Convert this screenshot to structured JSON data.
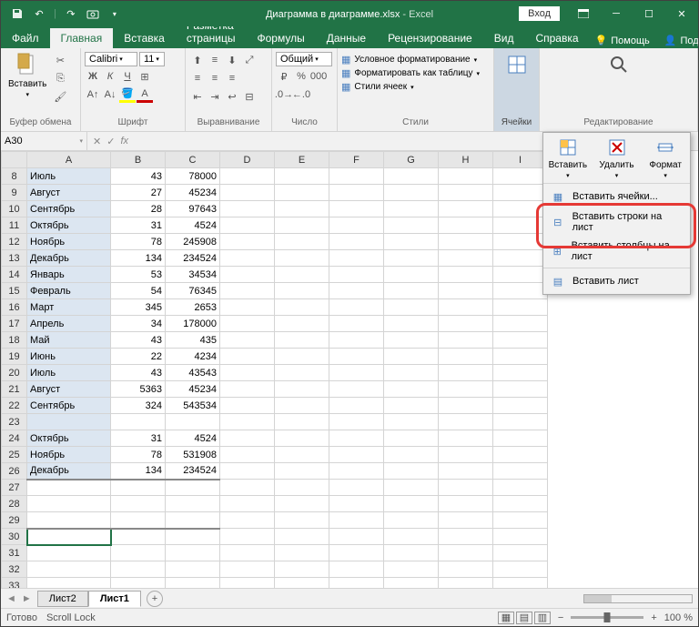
{
  "title": {
    "doc": "Диаграмма в диаграмме.xlsx",
    "sep": " - ",
    "app": "Excel"
  },
  "login": "Вход",
  "tabs": [
    "Файл",
    "Главная",
    "Вставка",
    "Разметка страницы",
    "Формулы",
    "Данные",
    "Рецензирование",
    "Вид",
    "Справка"
  ],
  "activeTab": 1,
  "help": "Помощь",
  "share": "Поделиться",
  "groups": {
    "clipboard": {
      "label": "Буфер обмена",
      "paste": "Вставить"
    },
    "font": {
      "label": "Шрифт",
      "name": "Calibri",
      "size": "11"
    },
    "align": {
      "label": "Выравнивание"
    },
    "number": {
      "label": "Число",
      "format": "Общий"
    },
    "styles": {
      "label": "Стили",
      "cond": "Условное форматирование",
      "table": "Форматировать как таблицу",
      "cells": "Стили ячеек"
    },
    "cells_grp": {
      "label": "Ячейки"
    },
    "editing": {
      "label": "Редактирование"
    }
  },
  "namebox": "A30",
  "cols": [
    "A",
    "B",
    "C",
    "D",
    "E",
    "F",
    "G",
    "H",
    "I"
  ],
  "rows": [
    {
      "n": 8,
      "a": "Июль",
      "b": 43,
      "c": 78000
    },
    {
      "n": 9,
      "a": "Август",
      "b": 27,
      "c": 45234
    },
    {
      "n": 10,
      "a": "Сентябрь",
      "b": 28,
      "c": 97643
    },
    {
      "n": 11,
      "a": "Октябрь",
      "b": 31,
      "c": 4524
    },
    {
      "n": 12,
      "a": "Ноябрь",
      "b": 78,
      "c": 245908
    },
    {
      "n": 13,
      "a": "Декабрь",
      "b": 134,
      "c": 234524
    },
    {
      "n": 14,
      "a": "Январь",
      "b": 53,
      "c": 34534
    },
    {
      "n": 15,
      "a": "Февраль",
      "b": 54,
      "c": 76345
    },
    {
      "n": 16,
      "a": "Март",
      "b": 345,
      "c": 2653
    },
    {
      "n": 17,
      "a": "Апрель",
      "b": 34,
      "c": 178000
    },
    {
      "n": 18,
      "a": "Май",
      "b": 43,
      "c": 435
    },
    {
      "n": 19,
      "a": "Июнь",
      "b": 22,
      "c": 4234
    },
    {
      "n": 20,
      "a": "Июль",
      "b": 43,
      "c": 43543
    },
    {
      "n": 21,
      "a": "Август",
      "b": 5363,
      "c": 45234
    },
    {
      "n": 22,
      "a": "Сентябрь",
      "b": 324,
      "c": 543534
    },
    {
      "n": 23,
      "a": "",
      "b": "",
      "c": ""
    },
    {
      "n": 24,
      "a": "Октябрь",
      "b": 31,
      "c": 4524
    },
    {
      "n": 25,
      "a": "Ноябрь",
      "b": 78,
      "c": 531908
    },
    {
      "n": 26,
      "a": "Декабрь",
      "b": 134,
      "c": 234524
    }
  ],
  "emptyRows": [
    27,
    28,
    29,
    30,
    31,
    32,
    33
  ],
  "sheets": [
    "Лист2",
    "Лист1"
  ],
  "activeSheet": 1,
  "status": {
    "ready": "Готово",
    "scroll": "Scroll Lock",
    "zoom": "100 %"
  },
  "dropdown": {
    "mini": {
      "insert": "Вставить",
      "delete": "Удалить",
      "format": "Формат"
    },
    "items": [
      "Вставить ячейки...",
      "Вставить строки на лист",
      "Вставить столбцы на лист",
      "Вставить лист"
    ]
  }
}
